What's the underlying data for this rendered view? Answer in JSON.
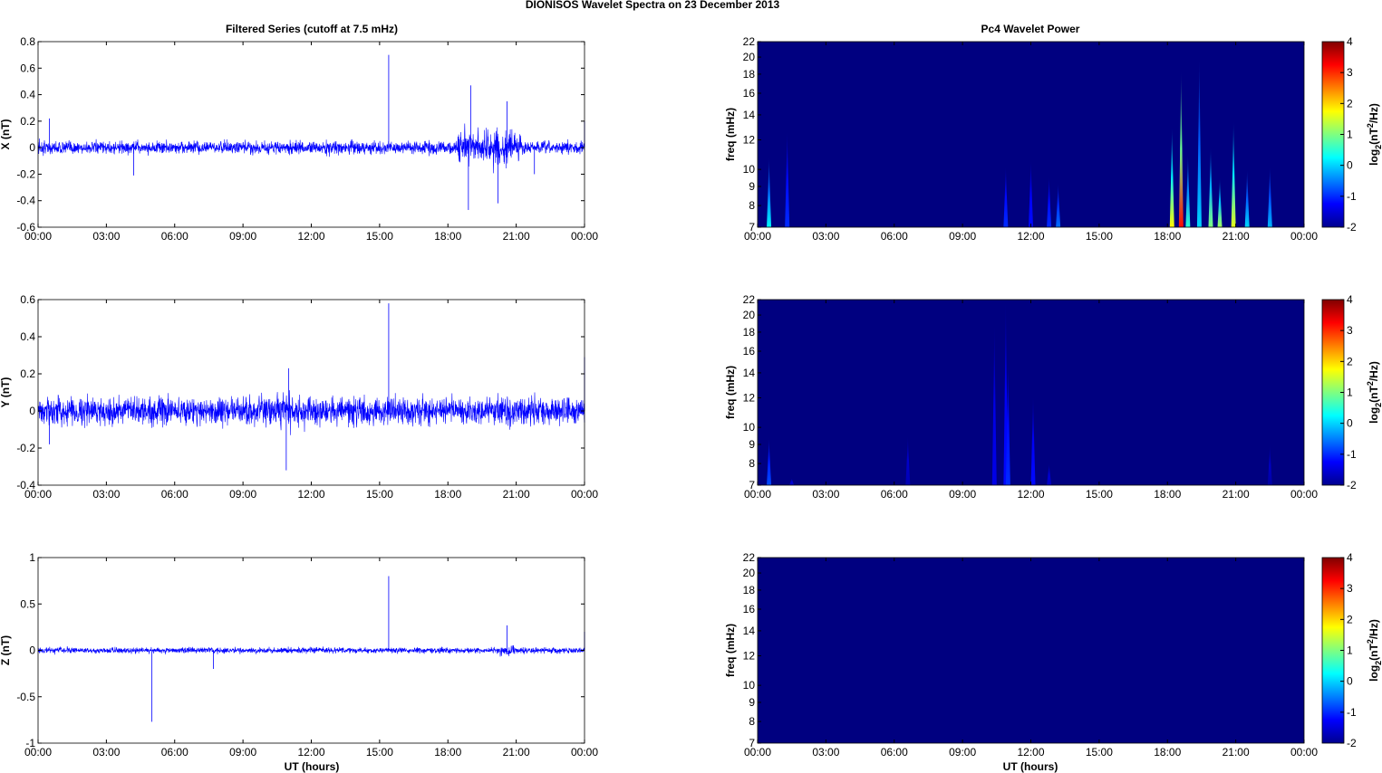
{
  "chart_data": {
    "title": "DIONISOS Wavelet Spectra on 23 December  2013",
    "left_title": "Filtered Series (cutoff at 7.5 mHz)",
    "right_title": "Pc4 Wavelet Power",
    "xlabel": "UT (hours)",
    "xticks": [
      "00:00",
      "03:00",
      "06:00",
      "09:00",
      "12:00",
      "15:00",
      "18:00",
      "21:00",
      "00:00"
    ],
    "xlim": [
      0,
      24
    ],
    "series_color": "#0000ff",
    "timeseries": [
      {
        "type": "line",
        "name": "X",
        "ylabel": "X (nT)",
        "ylim": [
          -0.6,
          0.8
        ],
        "yticks": [
          "-0.6",
          "-0.4",
          "-0.2",
          "0",
          "0.2",
          "0.4",
          "0.6",
          "0.8"
        ],
        "noise": 0.045,
        "active": [
          [
            18.4,
            21.2,
            0.17
          ],
          [
            0,
            0.5,
            0.07
          ]
        ],
        "spikes": [
          [
            15.4,
            0.7
          ],
          [
            4.2,
            -0.21
          ],
          [
            18.9,
            -0.47
          ],
          [
            19,
            0.47
          ],
          [
            20.2,
            -0.42
          ],
          [
            20.6,
            0.35
          ],
          [
            21.8,
            -0.2
          ],
          [
            0.5,
            0.22
          ],
          [
            24,
            0.2
          ]
        ]
      },
      {
        "type": "line",
        "name": "Y",
        "ylabel": "Y (nT)",
        "ylim": [
          -0.4,
          0.6
        ],
        "yticks": [
          "-0.4",
          "-0.2",
          "0",
          "0.2",
          "0.4",
          "0.6"
        ],
        "noise": 0.07,
        "active": [
          [
            10,
            12,
            0.1
          ],
          [
            20.2,
            20.8,
            0.08
          ]
        ],
        "spikes": [
          [
            15.4,
            0.58
          ],
          [
            10.9,
            -0.32
          ],
          [
            11,
            0.23
          ],
          [
            24,
            0.29
          ],
          [
            0.5,
            -0.18
          ]
        ]
      },
      {
        "type": "line",
        "name": "Z",
        "ylabel": "Z (nT)",
        "ylim": [
          -1,
          1
        ],
        "yticks": [
          "-1",
          "-0.5",
          "0",
          "0.5",
          "1"
        ],
        "noise": 0.03,
        "active": [
          [
            20.2,
            21,
            0.08
          ]
        ],
        "spikes": [
          [
            15.4,
            0.8
          ],
          [
            5,
            -0.77
          ],
          [
            20.6,
            0.27
          ],
          [
            7.7,
            -0.2
          ],
          [
            24,
            0.2
          ]
        ]
      }
    ],
    "spectra": [
      {
        "type": "heatmap",
        "ylabel": "freq (mHz)",
        "ylim": [
          7,
          22
        ],
        "yscale": "log",
        "background": -2,
        "bursts": [
          [
            0.5,
            10.8,
            0.2
          ],
          [
            1.3,
            12.7,
            -1
          ],
          [
            10.9,
            10.2,
            -1
          ],
          [
            12,
            10.6,
            -1.2
          ],
          [
            12.8,
            9.6,
            -1
          ],
          [
            13.2,
            9.2,
            -0.6
          ],
          [
            18.2,
            13,
            1.8
          ],
          [
            18.6,
            18.5,
            3.2
          ],
          [
            18.9,
            11,
            0.5
          ],
          [
            19.4,
            20,
            0
          ],
          [
            19.9,
            11.5,
            1
          ],
          [
            20.3,
            9.5,
            1.2
          ],
          [
            20.9,
            13.5,
            1.6
          ],
          [
            21.5,
            10,
            0
          ],
          [
            22.5,
            10.2,
            -0.2
          ]
        ]
      },
      {
        "type": "heatmap",
        "ylabel": "freq (mHz)",
        "ylim": [
          7,
          22
        ],
        "yscale": "log",
        "background": -2,
        "bursts": [
          [
            0.5,
            9.4,
            -0.8
          ],
          [
            1.5,
            7.3,
            -1.6
          ],
          [
            6.6,
            9.5,
            -1.7
          ],
          [
            10.4,
            19,
            -1.4
          ],
          [
            10.9,
            22,
            -1.2
          ],
          [
            11,
            15,
            -1
          ],
          [
            12.1,
            12.2,
            -1.2
          ],
          [
            12.8,
            8,
            -1.6
          ],
          [
            22.5,
            9,
            -1.8
          ]
        ]
      },
      {
        "type": "heatmap",
        "ylabel": "freq (mHz)",
        "ylim": [
          7,
          22
        ],
        "yscale": "log",
        "background": -2,
        "bursts": []
      }
    ],
    "yticks_freq": [
      "7",
      "8",
      "9",
      "10",
      "12",
      "14",
      "16",
      "18",
      "20",
      "22"
    ],
    "colorbar": {
      "label": "log2(nT2/Hz)",
      "range": [
        -2,
        4
      ],
      "ticks": [
        "-2",
        "-1",
        "0",
        "1",
        "2",
        "3",
        "4"
      ]
    }
  }
}
